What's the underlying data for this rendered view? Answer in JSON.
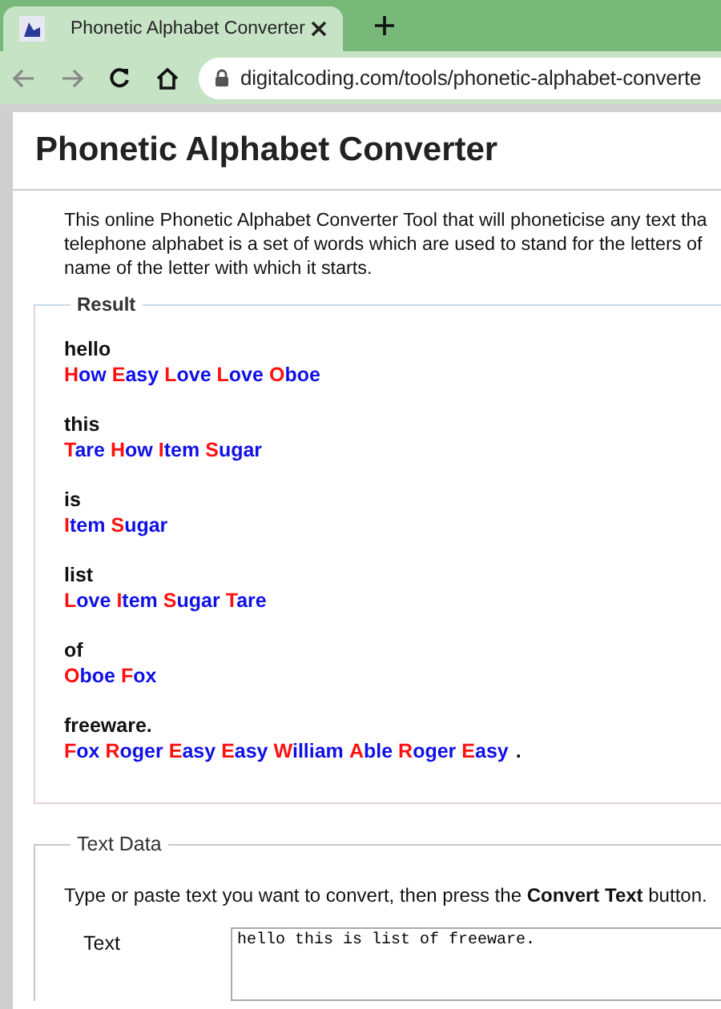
{
  "browser": {
    "tab_title": "Phonetic Alphabet Converter",
    "url": "digitalcoding.com/tools/phonetic-alphabet-converte"
  },
  "page": {
    "title": "Phonetic Alphabet Converter",
    "intro_lines": [
      "This online Phonetic Alphabet Converter Tool that will phoneticise any text tha",
      "telephone alphabet is a set of words which are used to stand for the letters of",
      "name of the letter with which it starts."
    ]
  },
  "result": {
    "legend": "Result",
    "entries": [
      {
        "word": "hello",
        "phonetic": [
          "How",
          "Easy",
          "Love",
          "Love",
          "Oboe"
        ]
      },
      {
        "word": "this",
        "phonetic": [
          "Tare",
          "How",
          "Item",
          "Sugar"
        ]
      },
      {
        "word": "is",
        "phonetic": [
          "Item",
          "Sugar"
        ]
      },
      {
        "word": "list",
        "phonetic": [
          "Love",
          "Item",
          "Sugar",
          "Tare"
        ]
      },
      {
        "word": "of",
        "phonetic": [
          "Oboe",
          "Fox"
        ]
      },
      {
        "word": "freeware.",
        "phonetic": [
          "Fox",
          "Roger",
          "Easy",
          "Easy",
          "William",
          "Able",
          "Roger",
          "Easy"
        ],
        "trailing": "."
      }
    ]
  },
  "text_data": {
    "legend": "Text Data",
    "instructions": "Type or paste text you want to convert, then press the **Convert Text** button.",
    "field_label": "Text",
    "field_value": "hello this is list of freeware."
  }
}
